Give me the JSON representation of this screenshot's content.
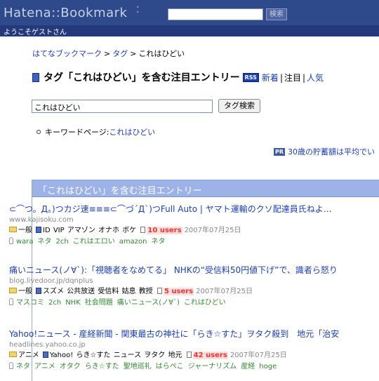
{
  "header": {
    "logo": "Hatena::Bookmark",
    "logo_chevron": "˄\n˅",
    "search_value": "",
    "search_button": "検索",
    "welcome": "ようこそゲストさん"
  },
  "breadcrumb": {
    "items": [
      "はてなブックマーク",
      "タグ"
    ],
    "separator": ">",
    "current": "これはひどい"
  },
  "page": {
    "title": "タグ「これはひどい」を含む注目エントリー",
    "rss": "RSS",
    "tabs": [
      "新着",
      "注目",
      "人気"
    ],
    "tab_sep": "|"
  },
  "tag_search": {
    "input_value": "これはひどい",
    "button": "タグ検索"
  },
  "keyword": {
    "label": "キーワードページ:",
    "link": "これはひどい"
  },
  "ad": {
    "badge": "PR",
    "text": "30歳の貯蓄額は平均でい"
  },
  "entries_box": {
    "title": "「これはひどい」を含む注目エントリー",
    "entries": [
      {
        "title": "⊂⌒つ。Д。)つカジ速≡≡≡⊂⌒づ´Д`)つFull Auto | ヤマト運輸のクソ配達員氏ねよ…",
        "domain": "www.kajisoku.com",
        "category": "一般",
        "mytags": [
          "ID",
          "VIP",
          "アマゾン",
          "オナホ",
          "ボケ"
        ],
        "users": "10 users",
        "date": "2007年07月25日",
        "tags": [
          "wara",
          "ネタ",
          "2ch",
          "これはエロい",
          "amazon",
          "ネタ"
        ]
      },
      {
        "title": "痛いニュース(ノ∀`):「視聴者をなめてる」 NHKの“受信料50円値下げ”で、識者ら怒り",
        "domain": "blog.livedoor.jp/dqnplus",
        "category": "一般",
        "mytags": [
          "スズメ",
          "公共放送",
          "受信料",
          "姑息",
          "教授"
        ],
        "users": "5 users",
        "date": "2007年07月25日",
        "tags": [
          "マスコミ",
          "2ch",
          "NHK",
          "社会問題",
          "痛いニュース(ノ∀`)",
          "これはひどい"
        ]
      },
      {
        "title": "Yahoo!ニュース - 産経新聞 - 関東最古の神社に「らき☆すた」ヲタク殺到　地元「治安",
        "domain": "headlines.yahoo.co.jp",
        "category": "アニメ",
        "mytags": [
          "Yahoo!",
          "らき☆すた",
          "ニュース",
          "ヲタク",
          "地元"
        ],
        "users": "42 users",
        "date": "2007年07月25日",
        "tags": [
          "ネタ",
          "アニメ",
          "オタク",
          "らき☆すた",
          "聖地巡礼",
          "はらぺこ",
          "ジャーナリズム",
          "産経",
          "hoge"
        ]
      }
    ]
  },
  "colors": {
    "header_bg": "#2f4a8a",
    "welcome_bg": "#24397a",
    "link": "#1a3db8",
    "box_header": "#9db3e8",
    "tag_green": "#2f8a2f",
    "users_red": "#e33"
  }
}
